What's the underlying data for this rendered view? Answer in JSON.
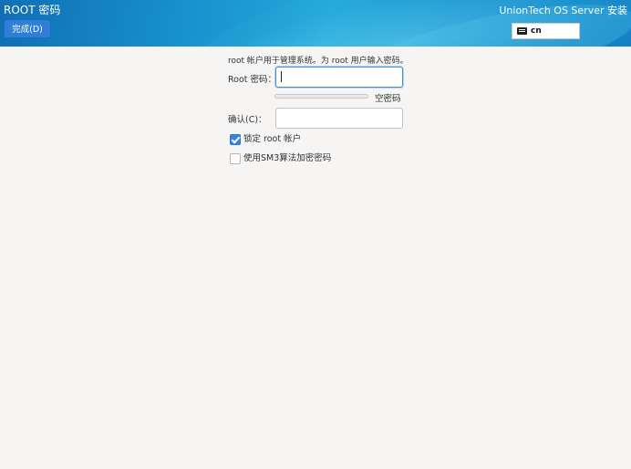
{
  "header": {
    "title": "ROOT 密码",
    "done_label": "完成(D)",
    "product_name": "UnionTech OS Server 安装",
    "keyboard_layout": "cn",
    "keyboard_icon": "keyboard-icon"
  },
  "form": {
    "instructions": "root 帐户用于管理系统。为 root 用户输入密码。",
    "root_password_label": "Root 密码：",
    "root_password_value": "",
    "strength_label": "空密码",
    "strength_level": 0,
    "confirm_label": "确认(C)：",
    "confirm_value": "",
    "lock_root_label": "锁定 root 帐户",
    "lock_root_checked": true,
    "sm3_label": "使用SM3算法加密密码",
    "sm3_checked": false
  },
  "colors": {
    "header_start": "#0f6fb5",
    "header_end": "#1481c4",
    "done_button": "#2d7fd8",
    "focus_border": "#4a90d9",
    "checkbox_checked": "#3584e4",
    "background": "#f6f5f4"
  }
}
